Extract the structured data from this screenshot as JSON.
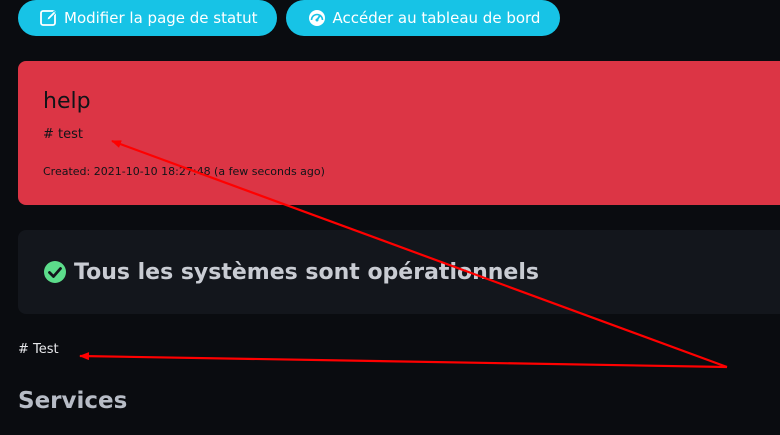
{
  "toolbar": {
    "edit_button": {
      "label": "Modifier la page de statut",
      "icon": "edit-icon"
    },
    "dashboard_button": {
      "label": "Accéder au tableau de bord",
      "icon": "speedometer-icon"
    }
  },
  "incident": {
    "title": "help",
    "body": "# test",
    "meta": "Created: 2021-10-10 18:27:48 (a few seconds ago)",
    "color": "#dc3545"
  },
  "status": {
    "icon": "check-circle-icon",
    "text": "Tous les systèmes sont opérationnels",
    "icon_color": "#5cdd8b"
  },
  "description": {
    "text": "# Test"
  },
  "services": {
    "title": "Services"
  },
  "annotations": {
    "color": "#ff0000",
    "arrow_count": 2
  },
  "colors": {
    "background": "#0a0c10",
    "accent": "#17c3e6",
    "card": "#13161c"
  }
}
